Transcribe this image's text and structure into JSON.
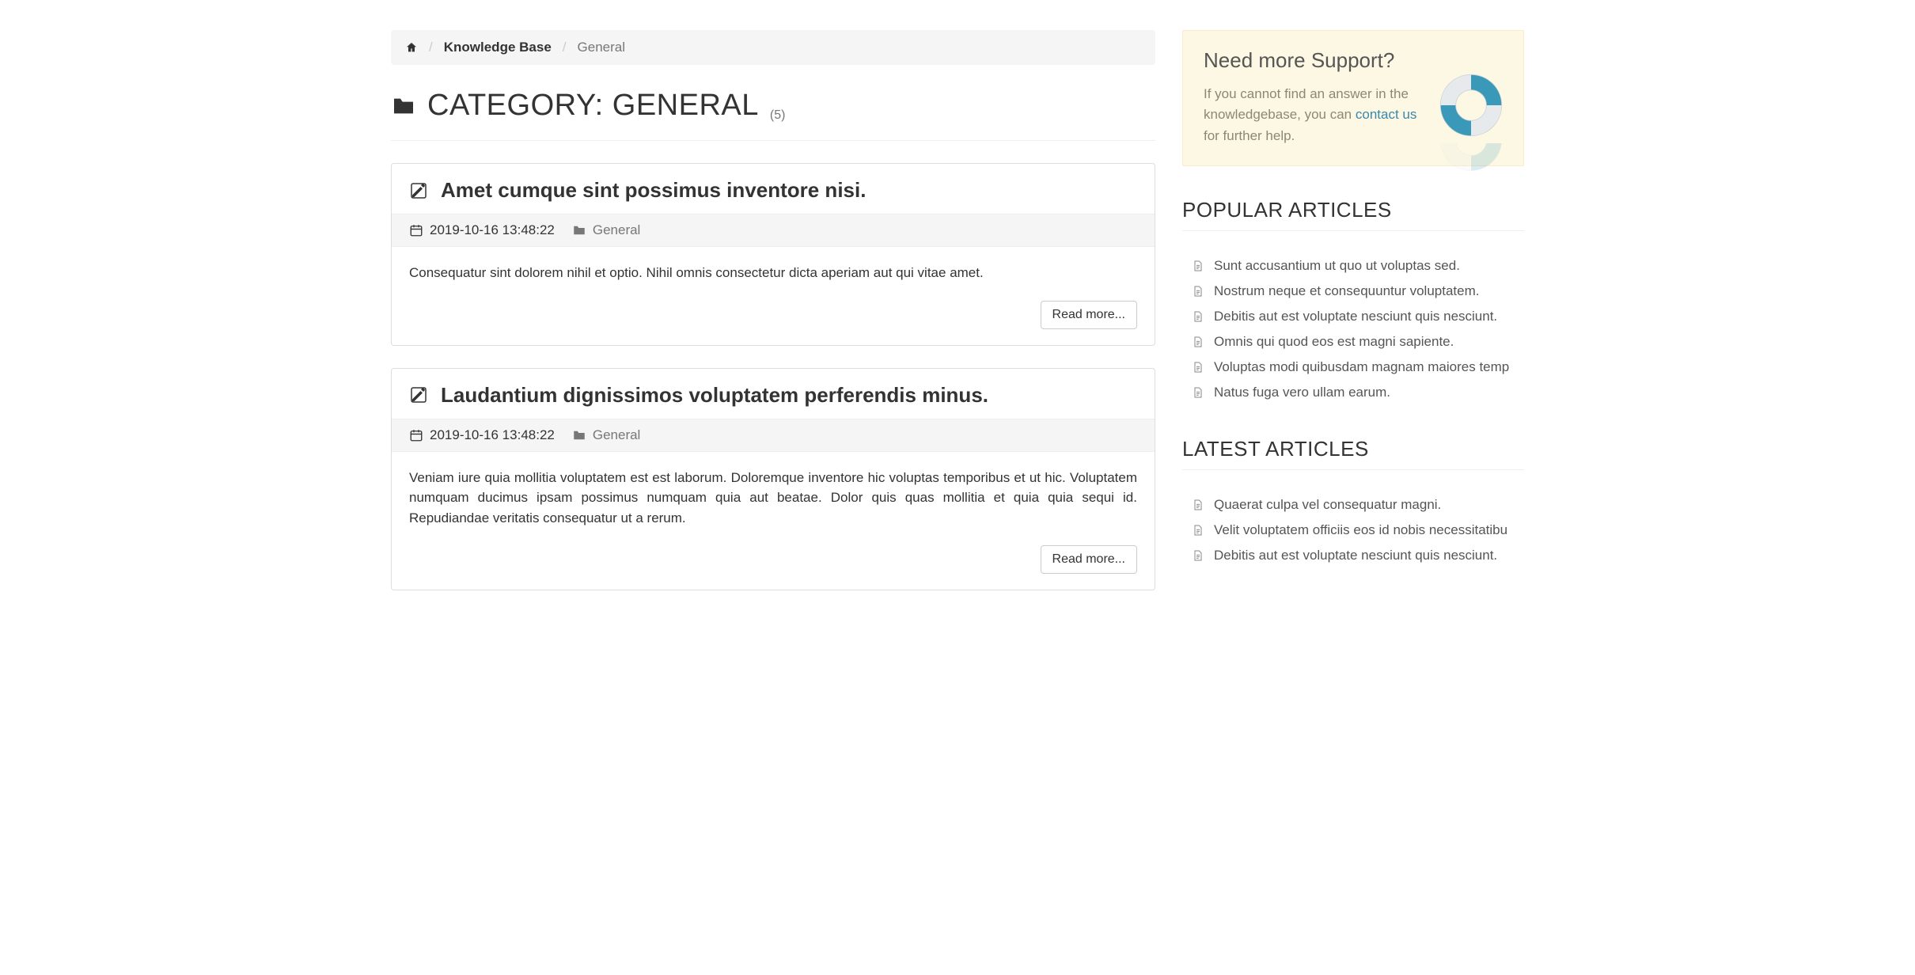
{
  "breadcrumb": {
    "kb_label": "Knowledge Base",
    "current": "General"
  },
  "page": {
    "heading": "CATEGORY: GENERAL",
    "count": "(5)"
  },
  "articles": [
    {
      "title": "Amet cumque sint possimus inventore nisi.",
      "date": "2019-10-16 13:48:22",
      "category": "General",
      "excerpt": "Consequatur sint dolorem nihil et optio. Nihil omnis consectetur dicta aperiam aut qui vitae amet.",
      "read_more": "Read more..."
    },
    {
      "title": "Laudantium dignissimos voluptatem perferendis minus.",
      "date": "2019-10-16 13:48:22",
      "category": "General",
      "excerpt": "Veniam iure quia mollitia voluptatem est est laborum. Doloremque inventore hic voluptas temporibus et ut hic. Voluptatem numquam ducimus ipsam possimus numquam quia aut beatae. Dolor quis quas mollitia et quia quia sequi id. Repudiandae veritatis consequatur ut a rerum.",
      "read_more": "Read more..."
    }
  ],
  "support": {
    "title": "Need more Support?",
    "text_before": "If you cannot find an answer in the knowledgebase, you can ",
    "link": "contact us",
    "text_after": " for further help."
  },
  "popular": {
    "heading": "POPULAR ARTICLES",
    "items": [
      "Sunt accusantium ut quo ut voluptas sed.",
      "Nostrum neque et consequuntur voluptatem.",
      "Debitis aut est voluptate nesciunt quis nesciunt.",
      "Omnis qui quod eos est magni sapiente.",
      "Voluptas modi quibusdam magnam maiores temp",
      "Natus fuga vero ullam earum."
    ]
  },
  "latest": {
    "heading": "LATEST ARTICLES",
    "items": [
      "Quaerat culpa vel consequatur magni.",
      "Velit voluptatem officiis eos id nobis necessitatibu",
      "Debitis aut est voluptate nesciunt quis nesciunt."
    ]
  }
}
